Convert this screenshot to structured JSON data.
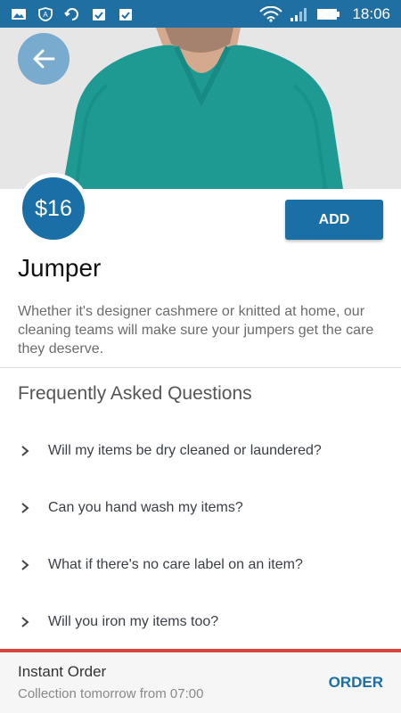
{
  "status_bar": {
    "time": "18:06",
    "icons": [
      "image-icon",
      "shield-icon",
      "sync-icon",
      "clipboard-check-icon",
      "clipboard-check-icon",
      "wifi-icon",
      "signal-icon",
      "battery-icon"
    ]
  },
  "hero": {
    "image": "teal-jumper-photo",
    "back_icon": "arrow-left-icon"
  },
  "product": {
    "price": "$16",
    "add_label": "ADD",
    "title": "Jumper",
    "description": "Whether it's designer cashmere or knitted at home, our cleaning teams will make sure your jumpers get the care they deserve."
  },
  "faq": {
    "heading": "Frequently Asked Questions",
    "items": [
      "Will my items be dry cleaned or laundered?",
      "Can you hand wash my items?",
      "What if there's no care label on an item?",
      "Will you iron my items too?"
    ]
  },
  "bottom": {
    "title": "Instant Order",
    "subtitle": "Collection tomorrow from 07:00",
    "order_label": "ORDER"
  },
  "colors": {
    "primary": "#1a6fa6",
    "status_bar": "#1f6fa3",
    "accent_red": "#d9443c",
    "sweater": "#1f9a93"
  }
}
